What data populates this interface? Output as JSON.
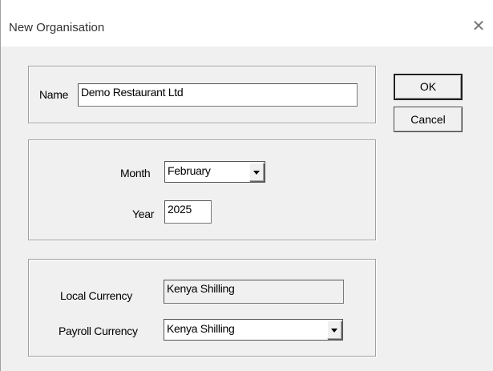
{
  "window": {
    "title": "New Organisation",
    "close_glyph": "✕"
  },
  "name_group": {
    "label": "Name",
    "value": "Demo Restaurant Ltd"
  },
  "period_group": {
    "month_label": "Month",
    "month_value": "February",
    "year_label": "Year",
    "year_value": "2025"
  },
  "currency_group": {
    "local_label": "Local Currency",
    "local_value": "Kenya Shilling",
    "payroll_label": "Payroll Currency",
    "payroll_value": "Kenya Shilling"
  },
  "buttons": {
    "ok": "OK",
    "cancel": "Cancel"
  },
  "icons": {
    "close": "close-icon",
    "dropdown": "chevron-down-icon"
  }
}
